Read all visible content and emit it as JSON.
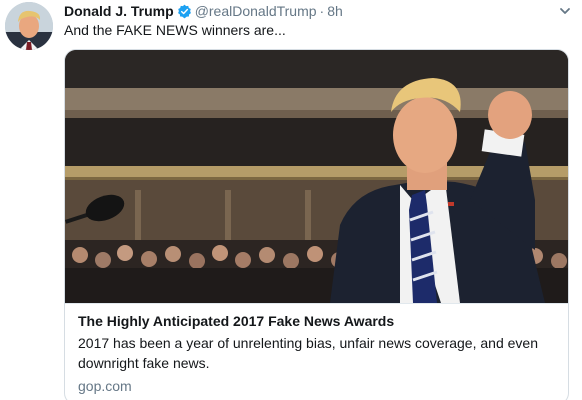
{
  "tweet": {
    "author": {
      "display_name": "Donald J. Trump",
      "handle": "@realDonaldTrump",
      "verified": true,
      "avatar_icon": "profile-photo",
      "verified_icon": "verified-badge-icon"
    },
    "separator": "·",
    "time": "8h",
    "text": "And the FAKE NEWS winners are...",
    "menu_icon": "chevron-down-icon",
    "card": {
      "image_icon": "photo-man-raising-fist-in-chamber",
      "title": "The Highly Anticipated 2017 Fake News Awards",
      "description": "2017 has been a year of unrelenting bias, unfair news coverage, and even downright fake news.",
      "domain": "gop.com"
    }
  },
  "colors": {
    "text_primary": "#14171a",
    "text_secondary": "#657786",
    "verified_blue": "#1da1f2",
    "border": "#d6dde3"
  }
}
